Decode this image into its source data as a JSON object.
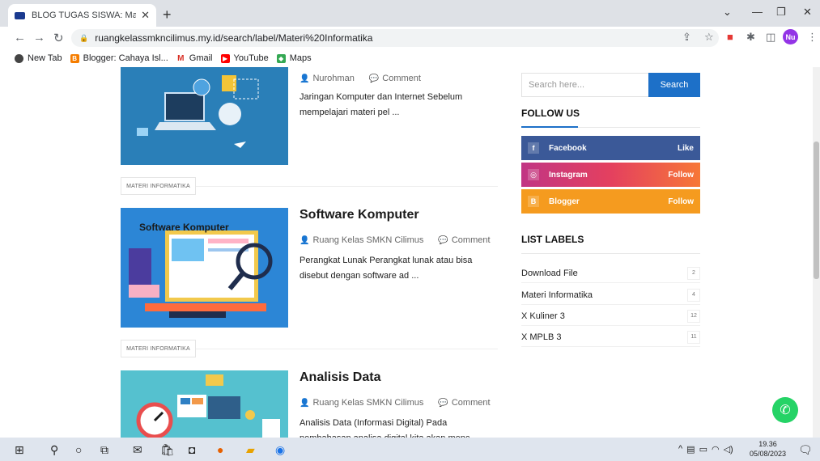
{
  "browser": {
    "tab_title": "BLOG TUGAS SISWA: Materi Info",
    "url": "ruangkelassmkncilimus.my.id/search/label/Materi%20Informatika",
    "profile_initials": "Nu",
    "bookmarks": [
      "New Tab",
      "Blogger: Cahaya Isl...",
      "Gmail",
      "YouTube",
      "Maps"
    ]
  },
  "posts": [
    {
      "author": "Nurohman",
      "comment": "Comment",
      "excerpt": "Jaringan Komputer dan Internet      Sebelum mempelajari materi pel ..."
    },
    {
      "label": "MATERI INFORMATIKA",
      "title": "Software Komputer",
      "image_caption": "Software Komputer",
      "author": "Ruang Kelas SMKN Cilimus",
      "comment": "Comment",
      "excerpt": "Perangkat Lunak     Perangkat lunak atau bisa disebut dengan software ad ..."
    },
    {
      "label": "MATERI INFORMATIKA",
      "title": "Analisis Data",
      "author": "Ruang Kelas SMKN Cilimus",
      "comment": "Comment",
      "excerpt": "Analisis Data (Informasi Digital)    Pada pembahasan analisa digital kita akan menc ..."
    }
  ],
  "sidebar": {
    "search_placeholder": "Search here...",
    "search_button": "Search",
    "follow_title": "FOLLOW US",
    "social": [
      {
        "name": "Facebook",
        "action": "Like",
        "color": "#3b5998"
      },
      {
        "name": "Instagram",
        "action": "Follow",
        "color": "#e4405f"
      },
      {
        "name": "Blogger",
        "action": "Follow",
        "color": "#f59b1f"
      }
    ],
    "labels_title": "LIST LABELS",
    "labels": [
      {
        "name": "Download File",
        "count": "2"
      },
      {
        "name": "Materi Informatika",
        "count": "4"
      },
      {
        "name": "X Kuliner 3",
        "count": "12"
      },
      {
        "name": "X MPLB 3",
        "count": "11"
      }
    ]
  },
  "taskbar": {
    "time": "19.36",
    "date": "05/08/2023"
  }
}
